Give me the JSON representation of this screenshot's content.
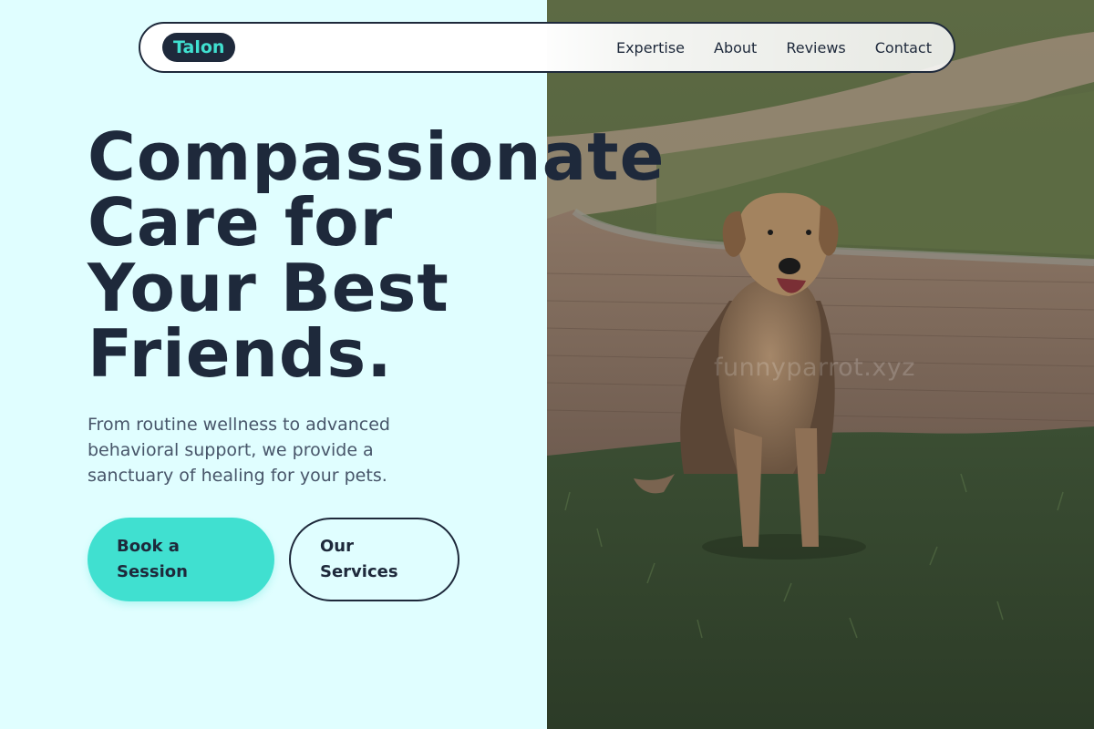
{
  "nav": {
    "logo": "Talon",
    "links": [
      "Expertise",
      "About",
      "Reviews",
      "Contact"
    ]
  },
  "hero": {
    "headline_lines": [
      "Compassionate",
      "Care for",
      "Your Best",
      "Friends."
    ],
    "subtext": "From routine wellness to advanced behavioral support, we provide a sanctuary of healing for your pets.",
    "primary_cta": "Book a Session",
    "secondary_cta": "Our Services"
  },
  "image": {
    "watermark": "funnyparrot.xyz"
  },
  "colors": {
    "accent": "#40e0d0",
    "text_dark": "#1e293b",
    "text_muted": "#475569",
    "background": "#e0feff"
  }
}
